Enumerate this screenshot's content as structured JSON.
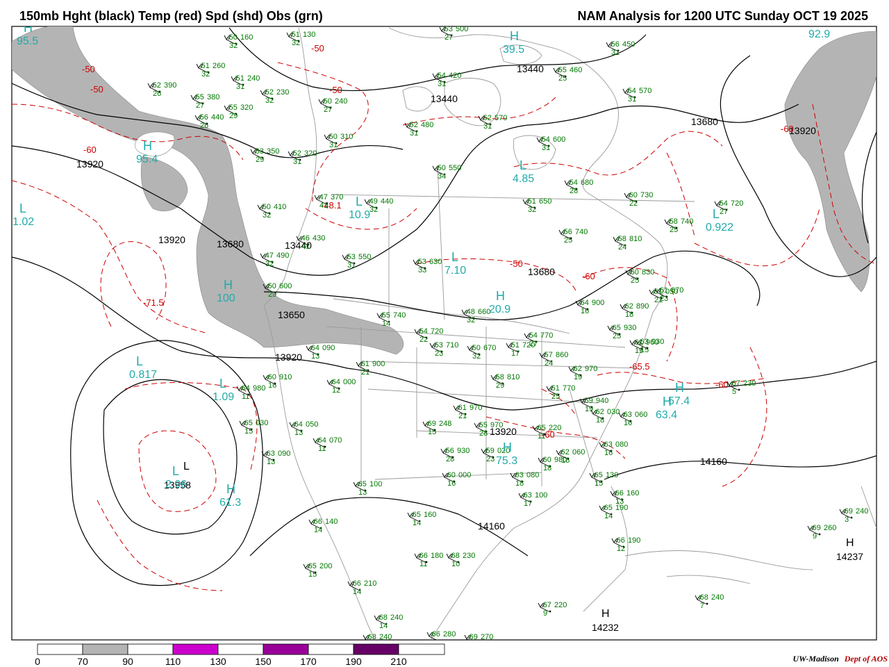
{
  "header": {
    "title_left": "150mb Hght (black) Temp (red) Spd (shd) Obs (grn)",
    "title_right": "NAM Analysis for 1200 UTC Sunday  OCT 19 2025"
  },
  "credit": {
    "org": "UW-Madison",
    "dept": "Dept of AOS"
  },
  "colors": {
    "height_contour": "#000000",
    "temperature_contour": "#cc0000",
    "speed_shade_70_90": "#b4b4b4",
    "speed_shade_110_130": "#cc00cc",
    "speed_shade_150_170": "#990099",
    "speed_shade_190_210": "#660066",
    "observations": "#007700",
    "pressure_centers": "#22aaaa",
    "basemap": "#999999"
  },
  "colorbar": {
    "labels": [
      "0",
      "70",
      "90",
      "110",
      "130",
      "150",
      "170",
      "190",
      "210"
    ],
    "segments": [
      {
        "from": 0,
        "to": 70,
        "color": "#ffffff"
      },
      {
        "from": 70,
        "to": 90,
        "color": "#b4b4b4"
      },
      {
        "from": 90,
        "to": 110,
        "color": "#ffffff"
      },
      {
        "from": 110,
        "to": 130,
        "color": "#cc00cc"
      },
      {
        "from": 130,
        "to": 150,
        "color": "#ffffff"
      },
      {
        "from": 150,
        "to": 170,
        "color": "#990099"
      },
      {
        "from": 170,
        "to": 190,
        "color": "#ffffff"
      },
      {
        "from": 190,
        "to": 210,
        "color": "#660066"
      }
    ]
  },
  "height_labels": [
    {
      "text": "13920"
    },
    {
      "text": "13920"
    },
    {
      "text": "13680"
    },
    {
      "text": "13440"
    },
    {
      "text": "13440"
    },
    {
      "text": "13440"
    },
    {
      "text": "13680"
    },
    {
      "text": "13680"
    },
    {
      "text": "13920"
    },
    {
      "text": "13650"
    },
    {
      "text": "13920"
    },
    {
      "text": "13920"
    },
    {
      "text": "14160"
    },
    {
      "text": "14160"
    },
    {
      "text": "13958"
    }
  ],
  "temp_labels": [
    {
      "text": "-50"
    },
    {
      "text": "-50"
    },
    {
      "text": "-60"
    },
    {
      "text": "-71.5"
    },
    {
      "text": "-50"
    },
    {
      "text": "-50"
    },
    {
      "text": "-48.1"
    },
    {
      "text": "-50"
    },
    {
      "text": "-60"
    },
    {
      "text": "-60"
    },
    {
      "text": "-65.5"
    },
    {
      "text": "-60"
    },
    {
      "text": "-60"
    }
  ],
  "centers": [
    {
      "kind": "H",
      "value": "95.5"
    },
    {
      "kind": "H",
      "value": "95.4"
    },
    {
      "kind": "L",
      "value": "1.02"
    },
    {
      "kind": "H",
      "value": "100"
    },
    {
      "kind": "L",
      "value": "0.817"
    },
    {
      "kind": "L",
      "value": "1.09"
    },
    {
      "kind": "H",
      "value": "61.3"
    },
    {
      "kind": "L",
      "value": "2.96"
    },
    {
      "kind": "L",
      "value": "10.9"
    },
    {
      "kind": "L",
      "value": "7.10"
    },
    {
      "kind": "L",
      "value": "4.85"
    },
    {
      "kind": "H",
      "value": "39.5"
    },
    {
      "kind": "H",
      "value": "92.9"
    },
    {
      "kind": "L",
      "value": "0.922"
    },
    {
      "kind": "H",
      "value": "63.4"
    },
    {
      "kind": "H",
      "value": "75.3"
    },
    {
      "kind": "H",
      "value": "20.9"
    },
    {
      "kind": "H",
      "value": "57.4"
    }
  ],
  "black_centers": [
    {
      "kind": "H",
      "value": "14237"
    },
    {
      "kind": "H",
      "value": "14232"
    },
    {
      "kind": "L",
      "value": ""
    }
  ],
  "obs": [
    {
      "t": "-50",
      "s": "160",
      "d": "32"
    },
    {
      "t": "-51",
      "s": "130",
      "d": "32"
    },
    {
      "t": "-51",
      "s": "260",
      "d": "32"
    },
    {
      "t": "-51",
      "s": "240",
      "d": "31"
    },
    {
      "t": "-52",
      "s": "390",
      "d": "26"
    },
    {
      "t": "-55",
      "s": "380",
      "d": "27"
    },
    {
      "t": "-55",
      "s": "320",
      "d": "29"
    },
    {
      "t": "-56",
      "s": "440",
      "d": "26"
    },
    {
      "t": "-52",
      "s": "230",
      "d": "32"
    },
    {
      "t": "-50",
      "s": "240",
      "d": "27"
    },
    {
      "t": "-50",
      "s": "310",
      "d": "31"
    },
    {
      "t": "-53",
      "s": "350",
      "d": "29"
    },
    {
      "t": "-52",
      "s": "320",
      "d": "31"
    },
    {
      "t": "-47",
      "s": "370",
      "d": "41"
    },
    {
      "t": "-49",
      "s": "440",
      "d": "32"
    },
    {
      "t": "-50",
      "s": "410",
      "d": "32"
    },
    {
      "t": "-46",
      "s": "430",
      "d": "41"
    },
    {
      "t": "-47",
      "s": "490",
      "d": "32"
    },
    {
      "t": "-53",
      "s": "550",
      "d": "31"
    },
    {
      "t": "-50",
      "s": "600",
      "d": "29"
    },
    {
      "t": "-53",
      "s": "500",
      "d": "27"
    },
    {
      "t": "-54",
      "s": "420",
      "d": "31"
    },
    {
      "t": "-52",
      "s": "480",
      "d": "31"
    },
    {
      "t": "-52",
      "s": "570",
      "d": "31"
    },
    {
      "t": "-56",
      "s": "450",
      "d": "31"
    },
    {
      "t": "-55",
      "s": "460",
      "d": "25"
    },
    {
      "t": "-54",
      "s": "570",
      "d": "31"
    },
    {
      "t": "-50",
      "s": "550",
      "d": "34"
    },
    {
      "t": "-54",
      "s": "600",
      "d": "31"
    },
    {
      "t": "-51",
      "s": "650",
      "d": "32"
    },
    {
      "t": "-54",
      "s": "680",
      "d": "28"
    },
    {
      "t": "-60",
      "s": "730",
      "d": "22"
    },
    {
      "t": "-54",
      "s": "720",
      "d": "27"
    },
    {
      "t": "-58",
      "s": "740",
      "d": "25"
    },
    {
      "t": "-56",
      "s": "740",
      "d": "25"
    },
    {
      "t": "-58",
      "s": "810",
      "d": "24"
    },
    {
      "t": "-53",
      "s": "630",
      "d": "33"
    },
    {
      "t": "-60",
      "s": "830",
      "d": "25"
    },
    {
      "t": "-61",
      "s": "870",
      "d": "23"
    },
    {
      "t": "-62",
      "s": "890",
      "d": "18"
    },
    {
      "t": "-64",
      "s": "900",
      "d": "16"
    },
    {
      "t": "-65",
      "s": "930",
      "d": "25"
    },
    {
      "t": "-63",
      "s": "930",
      "d": "15"
    },
    {
      "t": "-61",
      "s": "960",
      "d": "19"
    },
    {
      "t": "-48",
      "s": "660",
      "d": "32"
    },
    {
      "t": "-55",
      "s": "740",
      "d": "14"
    },
    {
      "t": "-54",
      "s": "720",
      "d": "22"
    },
    {
      "t": "-53",
      "s": "710",
      "d": "23"
    },
    {
      "t": "-50",
      "s": "670",
      "d": "32"
    },
    {
      "t": "-51",
      "s": "720",
      "d": "17"
    },
    {
      "t": "-54",
      "s": "770",
      "d": "27"
    },
    {
      "t": "-57",
      "s": "860",
      "d": "24"
    },
    {
      "t": "-62",
      "s": "970",
      "d": "19"
    },
    {
      "t": "-58",
      "s": "810",
      "d": "29"
    },
    {
      "t": "-51",
      "s": "770",
      "d": "25"
    },
    {
      "t": "-59",
      "s": "940",
      "d": "19"
    },
    {
      "t": "-62",
      "s": "030",
      "d": "18"
    },
    {
      "t": "-63",
      "s": "060",
      "d": "16"
    },
    {
      "t": "-64",
      "s": "090",
      "d": "13"
    },
    {
      "t": "-61",
      "s": "900",
      "d": "21"
    },
    {
      "t": "-60",
      "s": "910",
      "d": "16"
    },
    {
      "t": "-64",
      "s": "000",
      "d": "12"
    },
    {
      "t": "-64",
      "s": "980",
      "d": "11"
    },
    {
      "t": "-65",
      "s": "030",
      "d": "15"
    },
    {
      "t": "-64",
      "s": "050",
      "d": "13"
    },
    {
      "t": "-64",
      "s": "070",
      "d": "11"
    },
    {
      "t": "-63",
      "s": "090",
      "d": "13"
    },
    {
      "t": "-65",
      "s": "100",
      "d": "13"
    },
    {
      "t": "-66",
      "s": "140",
      "d": "14"
    },
    {
      "t": "-65",
      "s": "200",
      "d": "15"
    },
    {
      "t": "-66",
      "s": "210",
      "d": "14"
    },
    {
      "t": "-68",
      "s": "240",
      "d": "14"
    },
    {
      "t": "-68",
      "s": "240",
      "d": "12"
    },
    {
      "t": "-66",
      "s": "280",
      "d": "11"
    },
    {
      "t": "-69",
      "s": "270",
      "d": "13"
    },
    {
      "t": "-69",
      "s": "248",
      "d": "15"
    },
    {
      "t": "-61",
      "s": "970",
      "d": "21"
    },
    {
      "t": "-55",
      "s": "970",
      "d": "28"
    },
    {
      "t": "-56",
      "s": "930",
      "d": "28"
    },
    {
      "t": "-59",
      "s": "020",
      "d": "23"
    },
    {
      "t": "-60",
      "s": "000",
      "d": "16"
    },
    {
      "t": "-63",
      "s": "080",
      "d": "18"
    },
    {
      "t": "-63",
      "s": "100",
      "d": "17"
    },
    {
      "t": "-65",
      "s": "160",
      "d": "14"
    },
    {
      "t": "-66",
      "s": "180",
      "d": "11"
    },
    {
      "t": "-68",
      "s": "230",
      "d": "10"
    },
    {
      "t": "-65",
      "s": "220",
      "d": "11"
    },
    {
      "t": "-60",
      "s": "980",
      "d": "18"
    },
    {
      "t": "-62",
      "s": "060",
      "d": "16"
    },
    {
      "t": "-63",
      "s": "080",
      "d": "16"
    },
    {
      "t": "-65",
      "s": "130",
      "d": "15"
    },
    {
      "t": "-66",
      "s": "160",
      "d": "13"
    },
    {
      "t": "-65",
      "s": "190",
      "d": "14"
    },
    {
      "t": "-66",
      "s": "190",
      "d": "12"
    },
    {
      "t": "-67",
      "s": "220",
      "d": "9"
    },
    {
      "t": "-69",
      "s": "260",
      "d": "9"
    },
    {
      "t": "-69",
      "s": "240",
      "d": "3"
    },
    {
      "t": "-68",
      "s": "240",
      "d": "7"
    },
    {
      "t": "-67",
      "s": "230",
      "d": "5"
    },
    {
      "t": "-61",
      "s": "050",
      "d": "21"
    },
    {
      "t": "-64",
      "s": "010",
      "d": "24"
    }
  ]
}
